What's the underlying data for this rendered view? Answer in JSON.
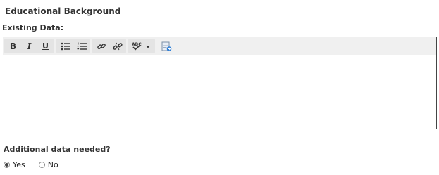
{
  "section": {
    "title": "Educational Background"
  },
  "field": {
    "label": "Existing Data:"
  },
  "toolbar": {
    "bold_label": "B",
    "italic_label": "I",
    "underline_label": "U",
    "bullet_list_icon": "bulleted-list-icon",
    "numbered_list_icon": "numbered-list-icon",
    "link_icon": "link-icon",
    "unlink_icon": "unlink-icon",
    "spellcheck_icon": "spellcheck-icon",
    "paste_icon": "paste-icon"
  },
  "editor": {
    "content": ""
  },
  "question": {
    "label": "Additional data needed?",
    "options": [
      {
        "label": "Yes",
        "selected": true
      },
      {
        "label": "No",
        "selected": false
      }
    ]
  }
}
